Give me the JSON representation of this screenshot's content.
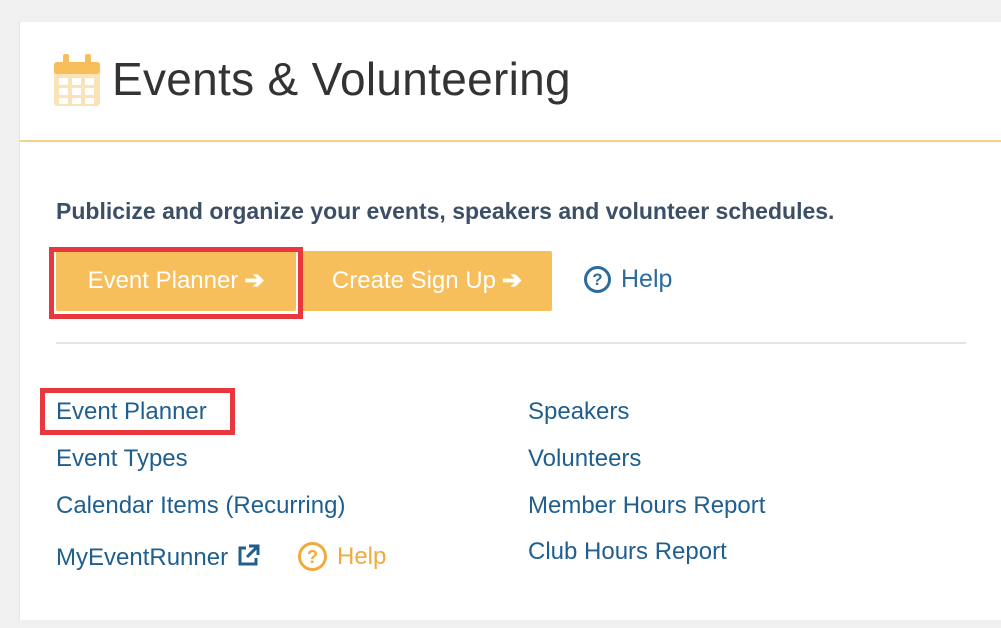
{
  "header": {
    "title": "Events & Volunteering",
    "icon": "calendar-icon",
    "accent_color": "#f6cd8a"
  },
  "description": "Publicize and organize your events, speakers and volunteer schedules.",
  "buttons": {
    "event_planner": "Event Planner",
    "create_sign_up": "Create Sign Up",
    "arrow_icon": "arrow-right-icon",
    "button_color": "#f7be5c"
  },
  "help_top": {
    "label": "Help",
    "icon": "question-circle-icon"
  },
  "links_left": [
    "Event Planner",
    "Event Types",
    "Calendar Items (Recurring)",
    "MyEventRunner"
  ],
  "links_right": [
    "Speakers",
    "Volunteers",
    "Member Hours Report",
    "Club Hours Report"
  ],
  "myeventrunner_icon": "external-link-icon",
  "help_bottom": {
    "label": "Help",
    "icon": "question-circle-icon",
    "color": "#f2aa3c"
  },
  "highlight_color": "#e8383d"
}
